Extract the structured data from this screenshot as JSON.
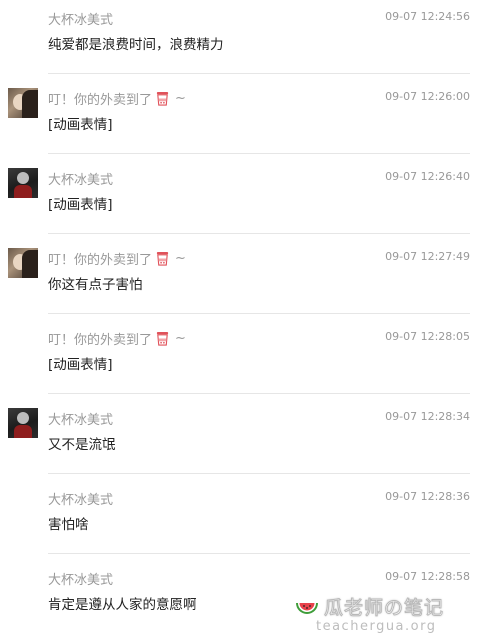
{
  "messages": [
    {
      "sender": "大杯冰美式",
      "time": "09-07 12:24:56",
      "text": "纯爱都是浪费时间，浪费精力",
      "avatar": "none"
    },
    {
      "sender": "叮！你的外卖到了",
      "sender_suffix": "~",
      "time": "09-07 12:26:00",
      "text": "[动画表情]",
      "avatar": "delivery-avatar"
    },
    {
      "sender": "大杯冰美式",
      "time": "09-07 12:26:40",
      "text": "[动画表情]",
      "avatar": "ice-avatar"
    },
    {
      "sender": "叮！你的外卖到了",
      "sender_suffix": "~",
      "time": "09-07 12:27:49",
      "text": "你这有点子害怕",
      "avatar": "delivery-avatar"
    },
    {
      "sender": "叮！你的外卖到了",
      "sender_suffix": "~",
      "time": "09-07 12:28:05",
      "text": "[动画表情]",
      "avatar": "none"
    },
    {
      "sender": "大杯冰美式",
      "time": "09-07 12:28:34",
      "text": "又不是流氓",
      "avatar": "ice-avatar"
    },
    {
      "sender": "大杯冰美式",
      "time": "09-07 12:28:36",
      "text": "害怕啥",
      "avatar": "none"
    },
    {
      "sender": "大杯冰美式",
      "time": "09-07 12:28:58",
      "text": "肯定是遵从人家的意愿啊",
      "avatar": "none"
    }
  ],
  "watermark": {
    "brand": "瓜老师の笔记",
    "url": "teachergua.org",
    "icon": "watermelon-icon"
  },
  "colors": {
    "meta_text": "#999999",
    "message_text": "#222222",
    "divider": "#e6e6e6",
    "cup_icon": "#e0525a"
  }
}
